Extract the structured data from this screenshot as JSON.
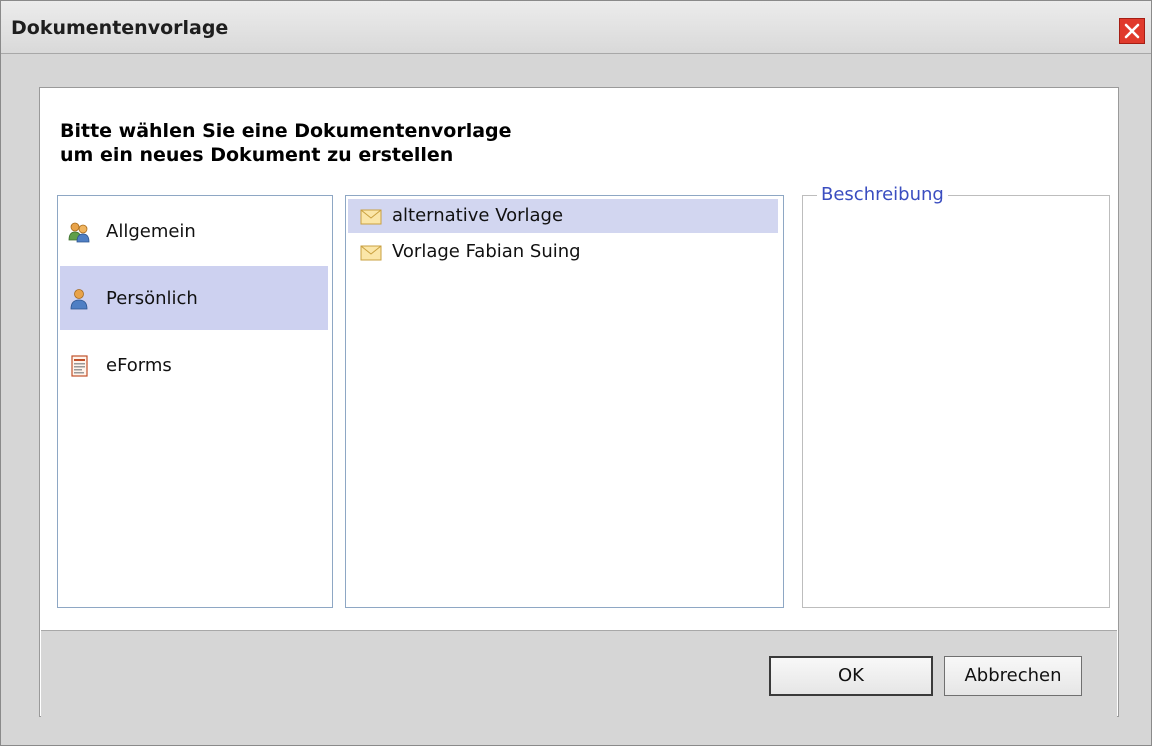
{
  "window": {
    "title": "Dokumentenvorlage"
  },
  "heading": {
    "line1": "Bitte wählen Sie eine Dokumentenvorlage",
    "line2": "um ein neues Dokument zu erstellen"
  },
  "categories": [
    {
      "label": "Allgemein",
      "icon": "group-icon",
      "selected": false
    },
    {
      "label": "Persönlich",
      "icon": "person-icon",
      "selected": true
    },
    {
      "label": "eForms",
      "icon": "form-icon",
      "selected": false
    }
  ],
  "templates": [
    {
      "label": "alternative Vorlage",
      "icon": "envelope-icon",
      "selected": true
    },
    {
      "label": "Vorlage Fabian Suing",
      "icon": "envelope-icon",
      "selected": false
    }
  ],
  "description": {
    "legend": "Beschreibung"
  },
  "buttons": {
    "ok": "OK",
    "cancel": "Abbrechen"
  },
  "colors": {
    "selection": "#cdd1f0",
    "close": "#e03a2c",
    "legend": "#3a4dc0"
  }
}
